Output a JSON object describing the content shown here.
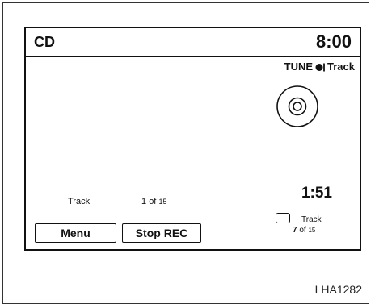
{
  "header": {
    "source": "CD",
    "clock": "8:00"
  },
  "tune_hint": {
    "prefix": "TUNE",
    "icon": "tune-knob-icon",
    "suffix": "Track"
  },
  "disc": {
    "icon": "disc-icon"
  },
  "playback": {
    "track_label": "Track",
    "track_position": "1",
    "track_of": "of",
    "track_total": "15",
    "elapsed": "1:51"
  },
  "buttons": {
    "menu": "Menu",
    "stop_rec": "Stop REC"
  },
  "track_select": {
    "label": "Track",
    "current": "7",
    "of": "of",
    "total": "15"
  },
  "figure_id": "LHA1282",
  "colors": {
    "foreground": "#111111",
    "background": "#ffffff"
  }
}
